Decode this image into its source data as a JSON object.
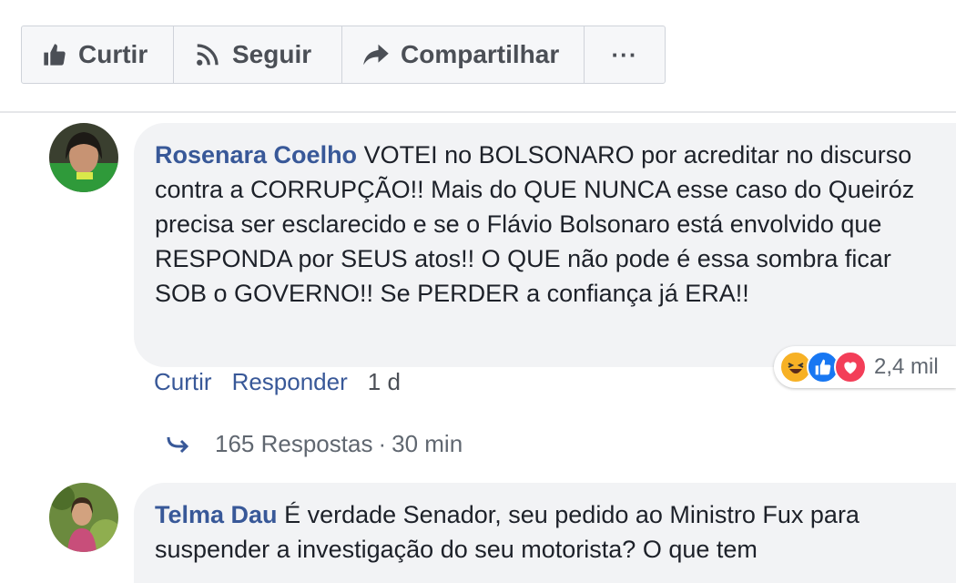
{
  "actions": {
    "like_label": "Curtir",
    "follow_label": "Seguir",
    "share_label": "Compartilhar",
    "more_label": "···"
  },
  "comments": [
    {
      "author": "Rosenara Coelho",
      "text": "VOTEI no BOLSONARO por acreditar no discurso contra a CORRUPÇÃO!! Mais do QUE NUNCA esse caso do Queiróz precisa ser esclarecido e se o Flávio Bolsonaro está envolvido que RESPONDA por SEUS atos!! O QUE não pode é essa sombra ficar SOB o GOVERNO!! Se PERDER a confiança já ERA!!",
      "reactions": {
        "icons": [
          "haha-icon",
          "like-icon",
          "love-icon"
        ],
        "count": "2,4 mil"
      },
      "like_label": "Curtir",
      "reply_label": "Responder",
      "time": "1 d",
      "replies": {
        "count_label": "165 Respostas",
        "separator": "·",
        "time": "30 min"
      }
    },
    {
      "author": "Telma Dau",
      "text": "É verdade Senador, seu pedido ao Ministro Fux para suspender a investigação do seu motorista? O que tem"
    }
  ],
  "colors": {
    "link": "#385898",
    "bubble_bg": "#f2f3f5",
    "haha": "#f7b125",
    "like": "#1877f2",
    "love": "#f33e58"
  }
}
